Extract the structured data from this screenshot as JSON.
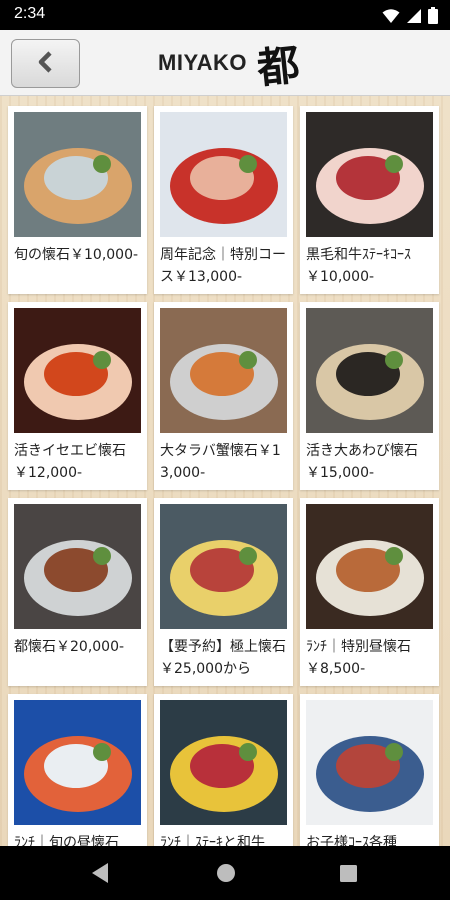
{
  "status": {
    "time": "2:34"
  },
  "header": {
    "brand_latin": "MIYAKO",
    "brand_kanji": "都"
  },
  "menu": [
    {
      "caption": "旬の懐石￥10,000-",
      "icon": "kaiseki-dish-photo",
      "colors": [
        "#6f7d80",
        "#c9d3d6",
        "#d9a46b"
      ]
    },
    {
      "caption": "周年記念｜特別コース￥13,000-",
      "icon": "anniversary-sushi-photo",
      "colors": [
        "#dfe5ec",
        "#e8b09a",
        "#c8322a"
      ]
    },
    {
      "caption": "黒毛和牛ｽﾃｰｷｺｰｽ￥10,000-",
      "icon": "wagyu-block-photo",
      "colors": [
        "#2e2a28",
        "#b4343a",
        "#f1d4cc"
      ]
    },
    {
      "caption": "活きイセエビ懐石￥12,000-",
      "icon": "spiny-lobster-photo",
      "colors": [
        "#3d1a14",
        "#d2471c",
        "#f0c9b0"
      ]
    },
    {
      "caption": "大タラバ蟹懐石￥13,000-",
      "icon": "king-crab-photo",
      "colors": [
        "#8a6a52",
        "#d57a3a",
        "#cfcfcf"
      ]
    },
    {
      "caption": "活き大あわび懐石￥15,000-",
      "icon": "abalone-photo",
      "colors": [
        "#5d5a55",
        "#2b2723",
        "#d9c7a6"
      ]
    },
    {
      "caption": "都懐石￥20,000-",
      "icon": "steak-teppan-photo",
      "colors": [
        "#4a4544",
        "#8c4a2e",
        "#cfd2d3"
      ]
    },
    {
      "caption": "【要予約】極上懐石￥25,000から",
      "icon": "premium-course-photo",
      "colors": [
        "#4b5a63",
        "#b8433b",
        "#e9d06a"
      ]
    },
    {
      "caption": "ﾗﾝﾁ｜特別昼懐石￥8,500-",
      "icon": "special-lunch-photo",
      "colors": [
        "#3a2a21",
        "#b96a3a",
        "#e6e1d6"
      ]
    },
    {
      "caption": "ﾗﾝﾁ｜旬の昼懐石",
      "icon": "seasonal-lunch-photo",
      "colors": [
        "#1c4fa8",
        "#eaeef2",
        "#e2623a"
      ]
    },
    {
      "caption": "ﾗﾝﾁ｜ｽﾃｰｷと和牛",
      "icon": "steak-lunch-photo",
      "colors": [
        "#2c3c46",
        "#b8303a",
        "#e8c33a"
      ]
    },
    {
      "caption": "お子様ｺｰｽ各種",
      "icon": "kids-course-photo",
      "colors": [
        "#eef0f2",
        "#b3453c",
        "#3b5d8f"
      ]
    }
  ]
}
